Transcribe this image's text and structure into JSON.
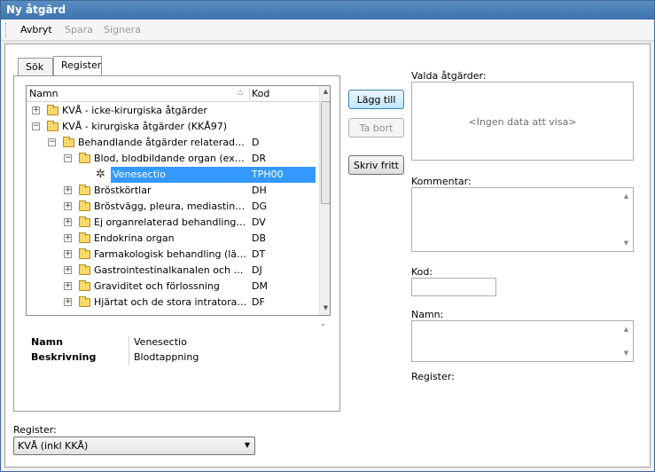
{
  "window": {
    "title": "Ny åtgärd"
  },
  "toolbar": {
    "cancel": "Avbryt",
    "save": "Spara",
    "sign": "Signera"
  },
  "tabs": {
    "search": "Sök",
    "register": "Register"
  },
  "tree": {
    "col_name": "Namn",
    "col_code": "Kod",
    "rows": [
      {
        "name": "KVÅ - icke-kirurgiska åtgärder",
        "code": ""
      },
      {
        "name": "KVÅ - kirurgiska åtgärder (KKÅ97)",
        "code": ""
      },
      {
        "name": "Behandlande åtgärder relaterade till ...",
        "code": "D"
      },
      {
        "name": "Blod, blodbildande organ (exkl. m...",
        "code": "DR"
      },
      {
        "name": "Venesectio",
        "code": "TPH00"
      },
      {
        "name": "Bröstkörtlar",
        "code": "DH"
      },
      {
        "name": "Bröstvägg, pleura, mediastinum, ...",
        "code": "DG"
      },
      {
        "name": "Ej organrelaterad behandling (ex...",
        "code": "DV"
      },
      {
        "name": "Endokrina organ",
        "code": "DB"
      },
      {
        "name": "Farmakologisk behandling (läkem...",
        "code": "DT"
      },
      {
        "name": "Gastrointestinalkanalen och därtil...",
        "code": "DJ"
      },
      {
        "name": "Graviditet och förlossning",
        "code": "DM"
      },
      {
        "name": "Hjärtat och de stora intratorakal...",
        "code": "DF"
      }
    ]
  },
  "details": {
    "name_label": "Namn",
    "name_value": "Venesectio",
    "desc_label": "Beskrivning",
    "desc_value": "Blodtappning"
  },
  "actions": {
    "add": "Lägg till",
    "remove": "Ta bort",
    "free_text": "Skriv fritt"
  },
  "right": {
    "selected_label": "Valda åtgärder:",
    "selected_empty": "<Ingen data att visa>",
    "comment_label": "Kommentar:",
    "code_label": "Kod:",
    "name_label": "Namn:",
    "register_label": "Register:"
  },
  "bottom": {
    "register_label": "Register:",
    "register_value": "KVÅ (inkl KKÅ)"
  }
}
